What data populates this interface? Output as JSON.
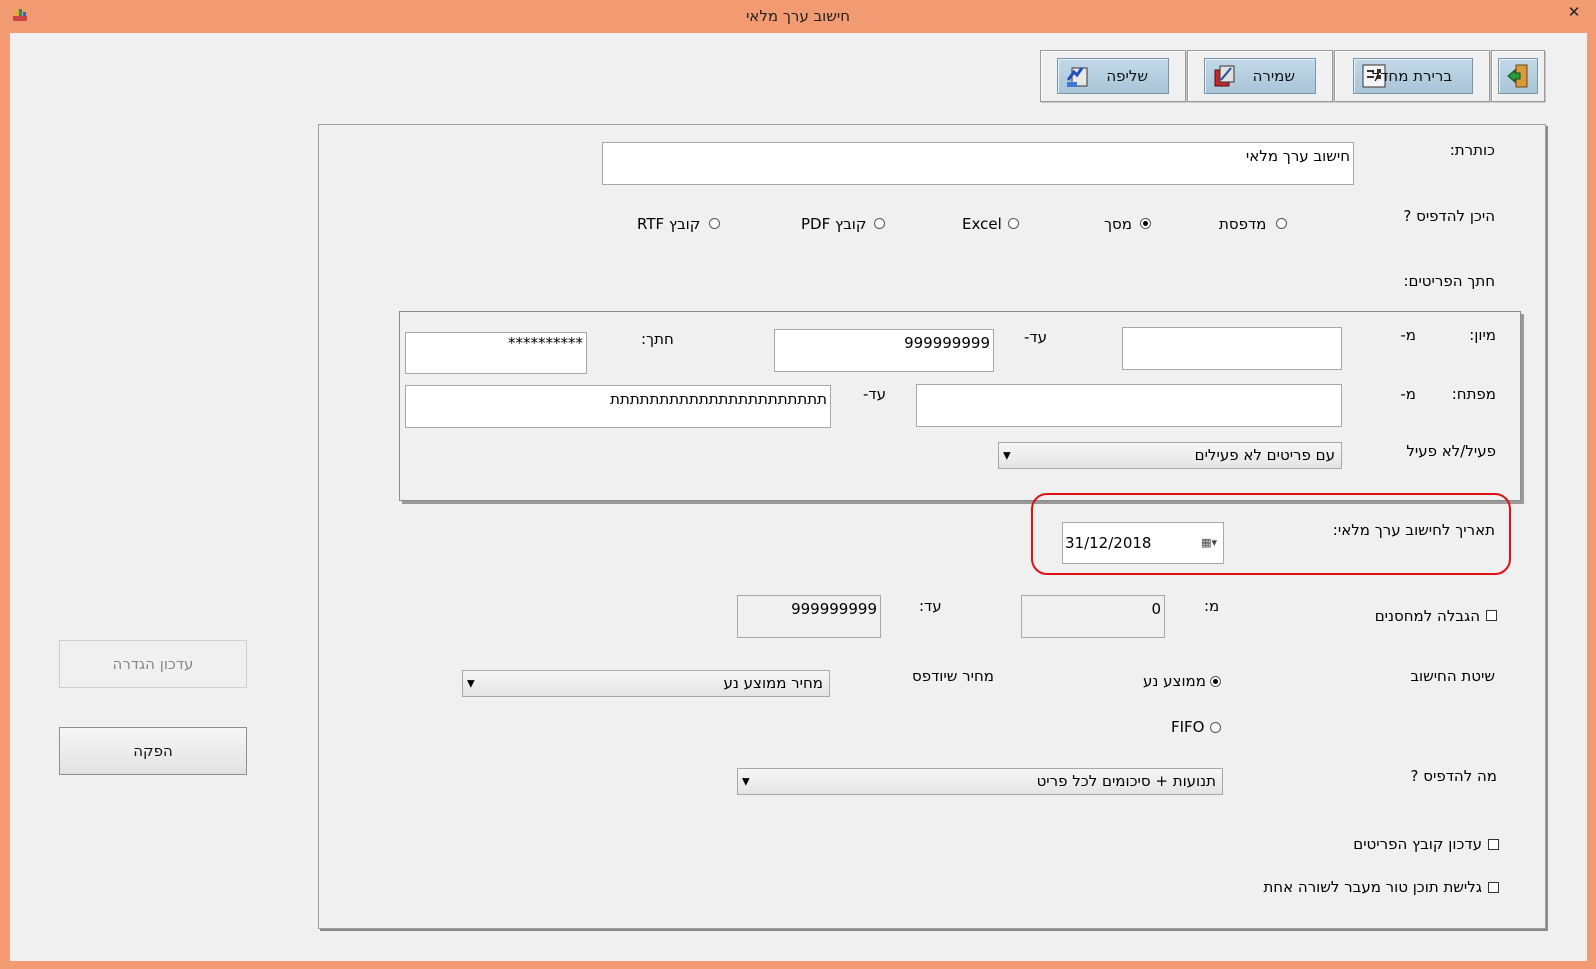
{
  "window": {
    "title": "חישוב ערך מלאי",
    "close": "✕"
  },
  "toolbar": {
    "retrieve": "שליפה",
    "save": "שמירה",
    "default_select": "ברירת מחדל"
  },
  "form": {
    "title_label": "כותרת:",
    "title_value": "חישוב ערך מלאי",
    "print_where_label": "היכן להדפיס ?",
    "print_options": [
      "מדפסת",
      "מסך",
      "Excel",
      "קובץ PDF",
      "קובץ RTF"
    ],
    "print_selected": "מסך",
    "items_section_label": "חתך הפריטים:",
    "sort_label": "מיון:",
    "from_label": "מ-",
    "to_label": "עד-",
    "sort_from": "",
    "sort_to": "999999999",
    "cut_label": "חתך:",
    "cut_value": "**********",
    "key_label": "מפתח:",
    "key_from": "",
    "key_to": "תתתתתתתתתתתתתתתתתתתתתת",
    "active_label": "פעיל/לא פעיל",
    "active_value": "עם פריטים לא פעילים",
    "date_label": "תאריך לחישוב ערך מלאי:",
    "date_value": "31/12/2018",
    "warehouse_label": "הגבלה למחסנים",
    "wh_from_label": "מ:",
    "wh_from": "0",
    "wh_to_label": "עד:",
    "wh_to": "999999999",
    "method_label": "שיטת החישוב",
    "method_moving_avg": "ממוצע נע",
    "method_fifo": "FIFO",
    "method_selected": "ממוצע נע",
    "price_label": "מחיר שיודפס",
    "price_value": "מחיר ממוצע נע",
    "what_print_label": "מה להדפיס ?",
    "what_print_value": "תנועות + סיכומים לכל פריט",
    "update_items_label": "עדכון קובץ הפריטים",
    "wrap_label": "גלישת תוכן טור מעבר לשורה אחת"
  },
  "side": {
    "update_definition": "עדכון הגדרה",
    "produce": "הפקה"
  },
  "colors": {
    "titlebar": "#f29a72",
    "highlight": "#e01010",
    "toolbar_button": "#b6cfe0"
  }
}
